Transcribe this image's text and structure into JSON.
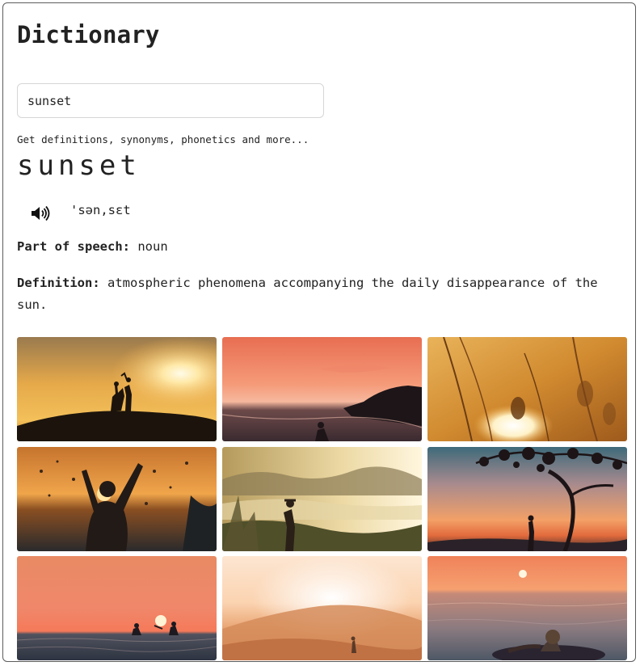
{
  "app": {
    "title": "Dictionary"
  },
  "search": {
    "value": "sunset",
    "hint": "Get definitions, synonyms, phonetics and more..."
  },
  "entry": {
    "word": "sunset",
    "phonetic": "'sən,sɛt",
    "audio_icon": "speaker-icon",
    "pos_label": "Part of speech:",
    "pos_value": "noun",
    "def_label": "Definition:",
    "def_value": "atmospheric phenomena accompanying the daily disappearance of the sun."
  },
  "gallery": {
    "images": [
      {
        "name": "couple-silhouette-sunset-photo"
      },
      {
        "name": "person-seashore-pink-sunset-photo"
      },
      {
        "name": "grass-closeup-sunset-photo"
      },
      {
        "name": "swimmer-splash-sunset-photo"
      },
      {
        "name": "hiker-valley-sunset-photo"
      },
      {
        "name": "person-under-tree-sunset-photo"
      },
      {
        "name": "surfers-ocean-sunset-photo"
      },
      {
        "name": "desert-dunes-sunset-photo"
      },
      {
        "name": "person-floating-sea-sunset-photo"
      }
    ]
  },
  "colors": {
    "text": "#222222",
    "border": "#5c5c5c",
    "input_border": "#d6d6d6"
  }
}
